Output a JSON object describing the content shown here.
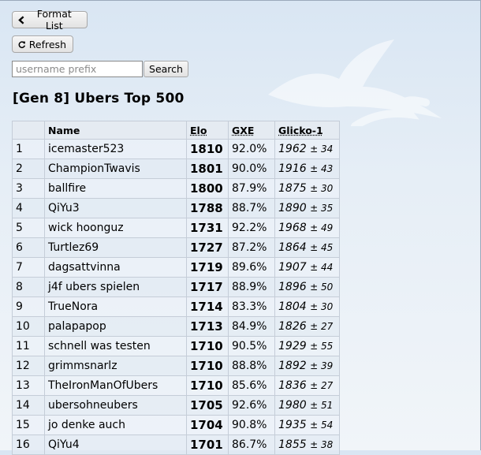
{
  "toolbar": {
    "format_list_label": "Format List",
    "refresh_label": "Refresh",
    "search_placeholder": "username prefix",
    "search_label": "Search"
  },
  "page": {
    "title": "[Gen 8] Ubers Top 500"
  },
  "table": {
    "headers": {
      "rank": "",
      "name": "Name",
      "elo": "Elo",
      "gxe": "GXE",
      "glicko": "Glicko-1"
    },
    "rows": [
      {
        "rank": "1",
        "name": "icemaster523",
        "elo": "1810",
        "gxe": "92.0%",
        "glicko": "1962",
        "dev": "± 34"
      },
      {
        "rank": "2",
        "name": "ChampionTwavis",
        "elo": "1801",
        "gxe": "90.0%",
        "glicko": "1916",
        "dev": "± 43"
      },
      {
        "rank": "3",
        "name": "ballfire",
        "elo": "1800",
        "gxe": "87.9%",
        "glicko": "1875",
        "dev": "± 30"
      },
      {
        "rank": "4",
        "name": "QiYu3",
        "elo": "1788",
        "gxe": "88.7%",
        "glicko": "1890",
        "dev": "± 35"
      },
      {
        "rank": "5",
        "name": "wick hoonguz",
        "elo": "1731",
        "gxe": "92.2%",
        "glicko": "1968",
        "dev": "± 49"
      },
      {
        "rank": "6",
        "name": "Turtlez69",
        "elo": "1727",
        "gxe": "87.2%",
        "glicko": "1864",
        "dev": "± 45"
      },
      {
        "rank": "7",
        "name": "dagsattvinna",
        "elo": "1719",
        "gxe": "89.6%",
        "glicko": "1907",
        "dev": "± 44"
      },
      {
        "rank": "8",
        "name": "j4f ubers spielen",
        "elo": "1717",
        "gxe": "88.9%",
        "glicko": "1896",
        "dev": "± 50"
      },
      {
        "rank": "9",
        "name": "TrueNora",
        "elo": "1714",
        "gxe": "83.3%",
        "glicko": "1804",
        "dev": "± 30"
      },
      {
        "rank": "10",
        "name": "palapapop",
        "elo": "1713",
        "gxe": "84.9%",
        "glicko": "1826",
        "dev": "± 27"
      },
      {
        "rank": "11",
        "name": "schnell was testen",
        "elo": "1710",
        "gxe": "90.5%",
        "glicko": "1929",
        "dev": "± 55"
      },
      {
        "rank": "12",
        "name": "grimmsnarlz",
        "elo": "1710",
        "gxe": "88.8%",
        "glicko": "1892",
        "dev": "± 39"
      },
      {
        "rank": "13",
        "name": "TheIronManOfUbers",
        "elo": "1710",
        "gxe": "85.6%",
        "glicko": "1836",
        "dev": "± 27"
      },
      {
        "rank": "14",
        "name": "ubersohneubers",
        "elo": "1705",
        "gxe": "92.6%",
        "glicko": "1980",
        "dev": "± 51"
      },
      {
        "rank": "15",
        "name": "jo denke auch",
        "elo": "1704",
        "gxe": "90.8%",
        "glicko": "1935",
        "dev": "± 54"
      },
      {
        "rank": "16",
        "name": "QiYu4",
        "elo": "1701",
        "gxe": "86.7%",
        "glicko": "1855",
        "dev": "± 38"
      }
    ]
  },
  "icons": {
    "back": "chevron-left-icon",
    "refresh": "refresh-icon"
  }
}
